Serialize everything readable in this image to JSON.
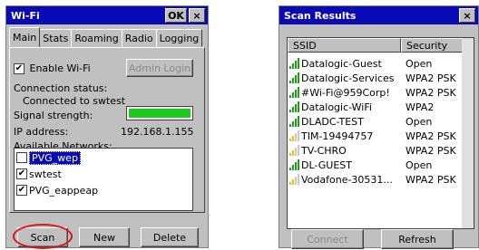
{
  "left_window": {
    "title": "Wi-Fi",
    "ok_label": "OK",
    "close_label": "×",
    "tabs": [
      "Main",
      "Stats",
      "Roaming",
      "Radio",
      "Logging"
    ],
    "enable_wifi_label": "Enable Wi-Fi",
    "enable_wifi_checked": true,
    "admin_login_label": "Admin Login",
    "connection_status_label": "Connection status:",
    "connection_status_value": "Connected to swtest",
    "signal_strength_label": "Signal strength:",
    "signal_level": 1.0,
    "ip_address_label": "IP address:",
    "ip_address_value": "192.168.1.155",
    "available_networks_label": "Available Networks:",
    "networks": [
      {
        "name": "PVG_wep",
        "checked": false,
        "selected": true
      },
      {
        "name": "swtest",
        "checked": true,
        "selected": false
      },
      {
        "name": "PVG_eappeap",
        "checked": true,
        "selected": false
      }
    ],
    "scan_label": "Scan",
    "new_label": "New",
    "delete_label": "Delete"
  },
  "right_window": {
    "title": "Scan Results",
    "close_label": "×",
    "columns": [
      "SSID",
      "Security"
    ],
    "results": [
      {
        "ssid": "Datalogic-Guest",
        "security": "Open",
        "bars": 4,
        "color": "#1aa01a"
      },
      {
        "ssid": "Datalogic-Services",
        "security": "WPA2 PSK",
        "bars": 4,
        "color": "#1aa01a"
      },
      {
        "ssid": "#Wi-Fi@959Corp!",
        "security": "WPA2 PSK",
        "bars": 4,
        "color": "#1aa01a"
      },
      {
        "ssid": "Datalogic-WiFi",
        "security": "WPA2",
        "bars": 4,
        "color": "#1aa01a"
      },
      {
        "ssid": "DLADC-TEST",
        "security": "Open",
        "bars": 4,
        "color": "#1aa01a"
      },
      {
        "ssid": "TIM-19494757",
        "security": "WPA2 PSK",
        "bars": 2,
        "color": "#e8c000"
      },
      {
        "ssid": "TV-CHRO",
        "security": "WPA2 PSK",
        "bars": 2,
        "color": "#e8c000"
      },
      {
        "ssid": "DL-GUEST",
        "security": "Open",
        "bars": 4,
        "color": "#1aa01a"
      },
      {
        "ssid": "Vodafone-30531...",
        "security": "WPA2 PSK",
        "bars": 2,
        "color": "#e8c000"
      }
    ],
    "connect_label": "Connect",
    "refresh_label": "Refresh"
  },
  "colors": {
    "title_bar": "#0a0ab4",
    "signal_fill": "#1fc81f",
    "highlight_circle": "#e01414"
  }
}
